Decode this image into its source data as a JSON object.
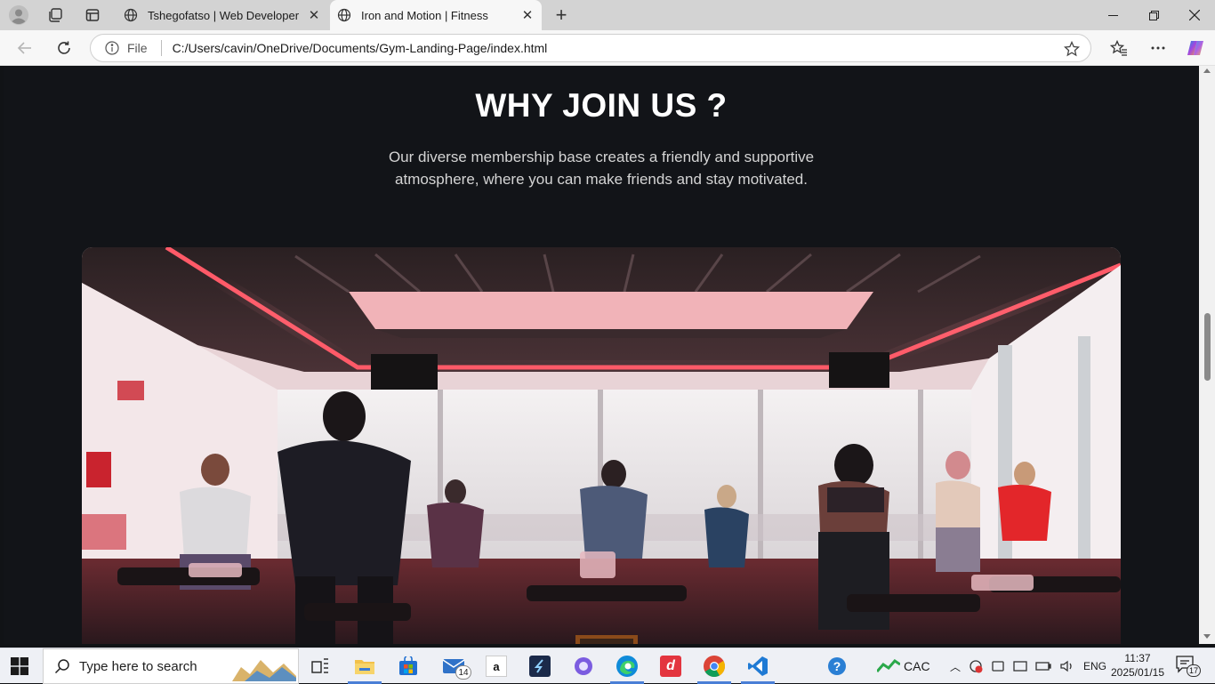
{
  "browser": {
    "tabs": [
      {
        "title": "Tshegofatso | Web Developer",
        "active": false
      },
      {
        "title": "Iron and Motion | Fitness",
        "active": true
      }
    ],
    "address_scheme_label": "File",
    "url": "C:/Users/cavin/OneDrive/Documents/Gym-Landing-Page/index.html"
  },
  "page": {
    "heading": "WHY JOIN US ?",
    "subtext": "Our diverse membership base creates a friendly and supportive atmosphere, where you can make friends and stay motivated.",
    "hero_image_alt": "Group spin class in a gym with red lighting",
    "scroll_position": 0.42
  },
  "taskbar": {
    "search_placeholder": "Type here to search",
    "mail_badge": "14",
    "weather_label": "CAC",
    "language": "ENG",
    "time": "11:37",
    "date": "2025/01/15",
    "notification_count": "17"
  },
  "colors": {
    "page_bg": "#121418",
    "heading": "#ffffff",
    "subtext": "#d4d4d4",
    "accent_red": "#e3353f"
  }
}
